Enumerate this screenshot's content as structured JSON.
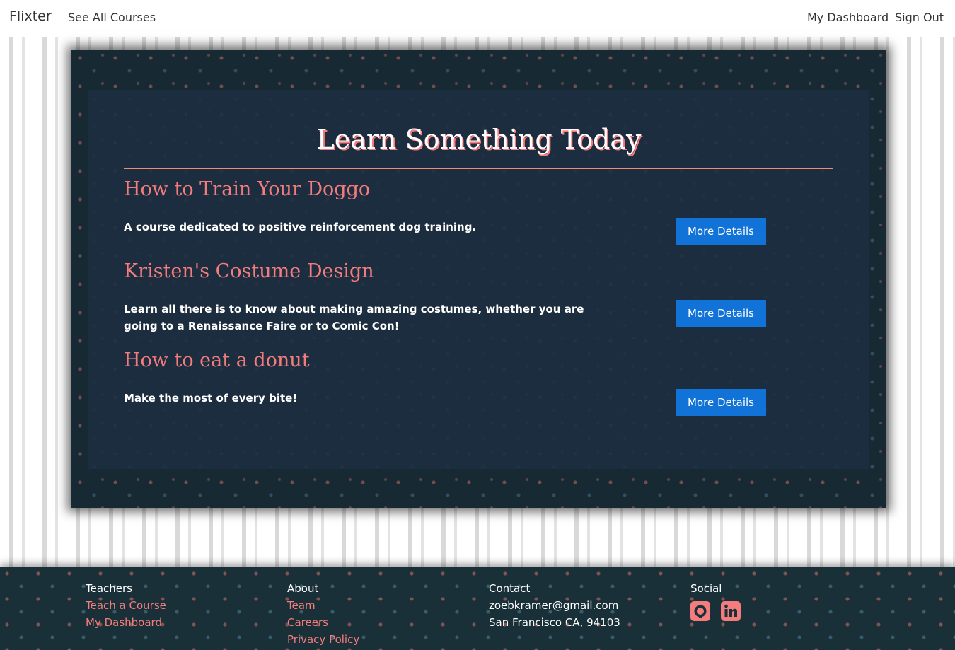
{
  "nav": {
    "brand": "Flixter",
    "all_courses": "See All Courses",
    "dashboard": "My Dashboard",
    "sign_out": "Sign Out"
  },
  "main": {
    "title": "Learn Something Today",
    "courses": [
      {
        "title": "How to Train Your Doggo",
        "description": "A course dedicated to positive reinforcement dog training.",
        "button": "More Details"
      },
      {
        "title": "Kristen's Costume Design",
        "description": "Learn all there is to know about making amazing costumes, whether you are going to a Renaissance Faire or to Comic Con!",
        "button": "More Details"
      },
      {
        "title": "How to eat a donut",
        "description": "Make the most of every bite!",
        "button": "More Details"
      }
    ]
  },
  "footer": {
    "teachers": {
      "heading": "Teachers",
      "links": [
        "Teach a Course",
        "My Dashboard"
      ]
    },
    "about": {
      "heading": "About",
      "links": [
        "Team",
        "Careers",
        "Privacy Policy"
      ]
    },
    "contact": {
      "heading": "Contact",
      "email": "zoebkramer@gmail.com",
      "address": "San Francisco CA, 94103"
    },
    "social": {
      "heading": "Social",
      "icons": [
        "github-icon",
        "linkedin-icon"
      ]
    }
  },
  "colors": {
    "accent": "#f47c7c",
    "button": "#1172d8",
    "panel": "#1c2d40",
    "footer": "#1a3038"
  }
}
